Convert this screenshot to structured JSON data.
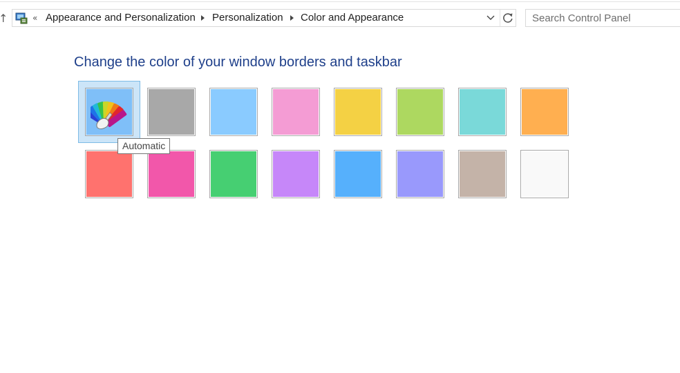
{
  "address_bar": {
    "overflow_chevron": "«",
    "breadcrumbs": [
      "Appearance and Personalization",
      "Personalization",
      "Color and Appearance"
    ]
  },
  "search": {
    "placeholder": "Search Control Panel",
    "value": ""
  },
  "main": {
    "heading": "Change the color of your window borders and taskbar",
    "selected_swatch": "Automatic",
    "tooltip": "Automatic",
    "swatches": [
      {
        "name": "Automatic",
        "color": "#7fbff8"
      },
      {
        "color": "#a8a8a8"
      },
      {
        "color": "#8acbff"
      },
      {
        "color": "#f49cd4"
      },
      {
        "color": "#f4d144"
      },
      {
        "color": "#add860"
      },
      {
        "color": "#7ad9d9"
      },
      {
        "color": "#ffaf50"
      },
      {
        "color": "#ff726e"
      },
      {
        "color": "#f257aa"
      },
      {
        "color": "#46cf72"
      },
      {
        "color": "#c687f9"
      },
      {
        "color": "#56b0fc"
      },
      {
        "color": "#9999fc"
      },
      {
        "color": "#c4b3a8"
      },
      {
        "color": "#f9f9f9"
      }
    ]
  },
  "icons": {
    "nav_up": "up-arrow-icon",
    "control_panel": "control-panel-icon",
    "breadcrumb_separator": "chevron-right-icon",
    "address_dropdown": "chevron-down-icon",
    "refresh": "refresh-icon",
    "automatic_color": "color-palette-icon"
  }
}
